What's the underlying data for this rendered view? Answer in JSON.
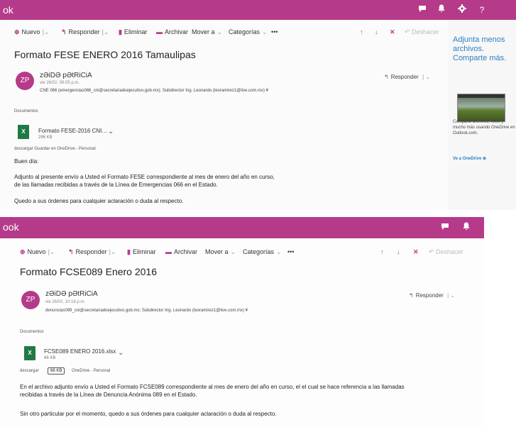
{
  "shot1": {
    "brand": "ok",
    "topbar_icons": [
      "chat-icon",
      "bell-icon",
      "gear-icon",
      "help-icon"
    ],
    "help_label": "?",
    "commands": {
      "new": "Nuevo",
      "reply": "Responder",
      "delete": "Eliminar",
      "archive": "Archivar",
      "move_to": "Mover a",
      "categories": "Categorías",
      "more": "•••",
      "undo": "Deshacer"
    },
    "subject": "Formato FESE ENERO 2016 Tamaulipas",
    "avatar_initials": "ZP",
    "sender": "zƏiDƏ pƏtRiCiA",
    "date": "vie 26/02, 08:05 p.m.",
    "recipients": "CNE 066 (emergencias066_cni@secretariadoejecutivo.gob.mx); Subdirector Ing. Leonardo (leoramirez1@live.com.mx) ¥",
    "reply_label": "Responder",
    "documents_label": "Documentos",
    "attachment": {
      "name": "Formato FESE-2016 CNI…",
      "size": "296 KB"
    },
    "attachment_actions": "descargar   Guardar en OneDrive - Personal",
    "body": [
      "Buen día:",
      "Adjunto al presente envío a Usted el Formato FESE correspondiente al mes de enero del año en curso,",
      "de las llamadas recibidas a través de la Línea de Emergencias 066 en el Estado.",
      "Quedo a sus órdenes para cualquier aclaración o duda al respecto."
    ],
    "side_pane": {
      "headline_1": "Adjunta menos",
      "headline_2": "archivos.",
      "headline_3": "Comparte más.",
      "text": "Comparte archivos, fotos y mucho más usando OneDrive en Outlook.com.",
      "link": "Ve a OneDrive"
    }
  },
  "shot2": {
    "brand": "ook",
    "commands": {
      "new": "Nuevo",
      "reply": "Responder",
      "delete": "Eliminar",
      "archive": "Archivar",
      "move_to": "Mover a",
      "categories": "Categorías",
      "more": "•••",
      "undo": "Deshacer"
    },
    "subject": "Formato FCSE089 Enero 2016",
    "avatar_initials": "ZP",
    "sender": "zƏiDƏ pƏtRiCiA",
    "date": "vie 26/02, 10:18 p.m.",
    "recipients": "denuncias089_cni@secretariadoejecutivo.gob.mx; Subdirector Ing. Leonardo (leoramirez1@live.com.mx) ¥",
    "reply_label": "Responder",
    "documents_label": "Documentos",
    "attachment": {
      "name": "FCSE089 ENERO 2016.xlsx",
      "size": "66 KB"
    },
    "attachment_actions_a": "descargar",
    "attachment_actions_b": "OneDrive - Personal",
    "tooltip": "66 KB",
    "body": [
      "En el archivo adjunto envío a Usted el Formato FCSE089 correspondiente al mes de enero del año en curso, el el cual se hace referencia a las llamadas",
      "recibidas a través de la Línea de Denuncia Anónima 089 en el Estado.",
      "Sin otro particular por el momento, quedo a sus órdenes para cualquier aclaración o duda al respecto."
    ]
  }
}
